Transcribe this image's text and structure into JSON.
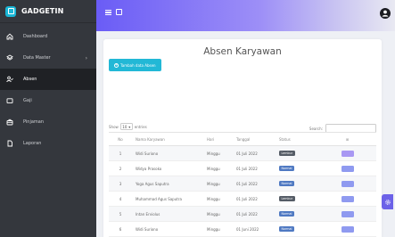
{
  "brand": {
    "name": "GADGETIN"
  },
  "sidebar": {
    "items": [
      {
        "label": "Dashboard",
        "icon": "home-icon",
        "active": false,
        "has_chevron": false
      },
      {
        "label": "Data Master",
        "icon": "layers-icon",
        "active": false,
        "has_chevron": true
      },
      {
        "label": "Absen",
        "icon": "user-check-icon",
        "active": true,
        "has_chevron": false
      },
      {
        "label": "Gaji",
        "icon": "folder-icon",
        "active": false,
        "has_chevron": false
      },
      {
        "label": "Pinjaman",
        "icon": "briefcase-icon",
        "active": false,
        "has_chevron": false
      },
      {
        "label": "Laporan",
        "icon": "file-icon",
        "active": false,
        "has_chevron": false
      }
    ]
  },
  "main": {
    "title": "Absen Karyawan",
    "add_button_label": "Tambah data Absen",
    "show_prefix": "Show",
    "show_value": "10",
    "show_suffix": "entries",
    "search_label": "Search:"
  },
  "table": {
    "headers": [
      "No",
      "Nama Karyawan",
      "Hari",
      "Tanggal",
      "Status",
      "⊞"
    ],
    "rows": [
      {
        "no": "1",
        "nama": "Widi Suriono",
        "hari": "Minggu",
        "tanggal": "01 Juli 2022",
        "status": "Lembur"
      },
      {
        "no": "2",
        "nama": "Widya Prasoko",
        "hari": "Minggu",
        "tanggal": "01 Juli 2022",
        "status": "Normal"
      },
      {
        "no": "3",
        "nama": "Yoga Agus Saputra",
        "hari": "Minggu",
        "tanggal": "01 Juli 2022",
        "status": "Normal"
      },
      {
        "no": "4",
        "nama": "Muhammad Agus Saputra",
        "hari": "Minggu",
        "tanggal": "01 Juli 2022",
        "status": "Lembur"
      },
      {
        "no": "5",
        "nama": "Intan Erviolus",
        "hari": "Minggu",
        "tanggal": "01 Juli 2022",
        "status": "Normal"
      },
      {
        "no": "6",
        "nama": "Widi Suriono",
        "hari": "Minggu",
        "tanggal": "01 Juni 2022",
        "status": "Normal"
      }
    ]
  },
  "colors": {
    "sidebar_bg": "#34373d",
    "accent": "#22b8d6",
    "topbar_start": "#6a5cf6",
    "badge_normal": "#4f79c2",
    "badge_lembur": "#555c66"
  }
}
